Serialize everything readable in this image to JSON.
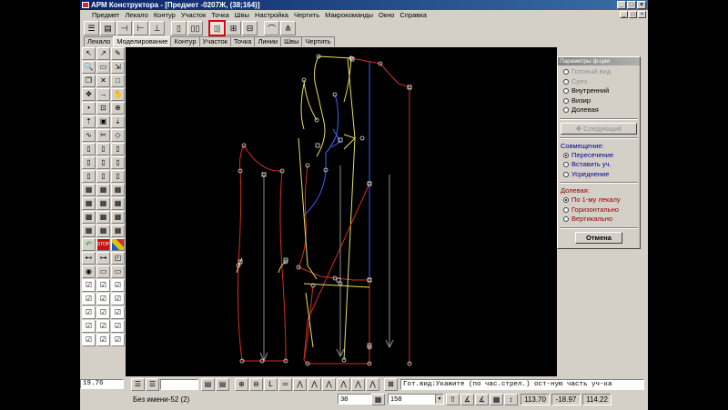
{
  "window": {
    "title": "АРМ Конструктора - [Предмет -0207Ж, (38;164)]",
    "controls": [
      "_",
      "□",
      "×"
    ]
  },
  "menu": [
    "Предмет",
    "Лекало",
    "Контур",
    "Участок",
    "Точка",
    "Швы",
    "Настройка",
    "Чертить",
    "Макрокоманды",
    "Окно",
    "Справка"
  ],
  "mdi_controls": [
    "_",
    "□",
    "×"
  ],
  "toolbar": {
    "icons": [
      "align-h-icon",
      "align-v-icon",
      "split-left-icon",
      "split-right-icon",
      "split-both-icon",
      "pattern-piece-icon",
      "pair-pieces-icon",
      "join-pieces-icon",
      "mirror-piece-icon",
      "symmetric-piece-icon",
      "contour-icon",
      "fan-icon"
    ],
    "selected_index": 6
  },
  "tabs": [
    "Лекало",
    "Моделирование",
    "Контур",
    "Участок",
    "Точка",
    "Линии",
    "Швы",
    "Чертить"
  ],
  "active_tab": 1,
  "left_tools": [
    "pointer-icon",
    "line-arrow-icon",
    "pencil-icon",
    "magnifier-icon",
    "window-icon",
    "window-arrow-icon",
    "copy-icon",
    "cross-icon",
    "square-icon",
    "move-icon",
    "arrow-right-icon",
    "hand-icon",
    "point-icon",
    "point-rect-icon",
    "point-plus-icon",
    "point-up-icon",
    "box-icon",
    "box-down-icon",
    "curve-icon",
    "knife-icon",
    "eraser-icon",
    "piece-a-icon",
    "piece-b-icon",
    "piece-c-icon",
    "piece-d-icon",
    "piece-e-icon",
    "piece-f-icon",
    "piece-g-icon",
    "piece-h-icon",
    "piece-i-icon",
    "grid-a-icon",
    "grid-b-icon",
    "grid-c-icon",
    "grid-d-icon",
    "grid-e-icon",
    "grid-f-icon",
    "grid-g-icon",
    "grid-h-icon",
    "grid-i-icon",
    "grid-j-icon",
    "grid-k-icon",
    "grid-l-icon",
    "undo-icon",
    "stop-icon",
    "palette-icon",
    "link-icon",
    "chain-icon",
    "shape-icon",
    "dot-icon",
    "rect-icon",
    "rect-b-icon",
    "check-a-icon",
    "check-b-icon",
    "check-c-icon",
    "check-d-icon",
    "check-e-icon",
    "check-f-icon",
    "check-g-icon",
    "check-h-icon",
    "check-i-icon",
    "check-j-icon",
    "check-k-icon",
    "check-l-icon",
    "check-m-icon",
    "check-n-icon",
    "check-o-icon"
  ],
  "params_panel": {
    "title": "Параметры ф-ции",
    "mode_options": [
      {
        "label": "Готовый вид",
        "enabled": false,
        "selected": false
      },
      {
        "label": "Срез",
        "enabled": false,
        "selected": false
      },
      {
        "label": "Внутренний",
        "enabled": true,
        "selected": false
      },
      {
        "label": "Визир",
        "enabled": true,
        "selected": false
      },
      {
        "label": "Долевая",
        "enabled": true,
        "selected": false
      }
    ],
    "next_button": "Следующий",
    "align_title": "Совмещение:",
    "align_options": [
      {
        "label": "Пересечение",
        "selected": true
      },
      {
        "label": "Вставить уч.",
        "selected": false
      },
      {
        "label": "Усреднение",
        "selected": false
      }
    ],
    "grain_title": "Долевая:",
    "grain_options": [
      {
        "label": "По 1-му лекалу",
        "selected": true
      },
      {
        "label": "Горизонтально",
        "selected": false
      },
      {
        "label": "Вертикально",
        "selected": false
      }
    ],
    "cancel_button": "Отмена"
  },
  "bottom_toolbar": {
    "coordinate": "19.76",
    "prompt": "Гот.вид:Укажите (по час.стрел.) ост-ную часть уч-ка"
  },
  "status": {
    "file_name": "Без имени-52 (2)",
    "size_value": "38",
    "height_value": "158",
    "readouts": [
      "113.70",
      "-18.97",
      "114.22"
    ]
  },
  "colors": {
    "title_gradient_start": "#0a246a",
    "selected_tool_outline": "#e00010",
    "pattern_red": "#d03020",
    "pattern_yellow": "#e8e060",
    "pattern_blue": "#4060ff"
  }
}
